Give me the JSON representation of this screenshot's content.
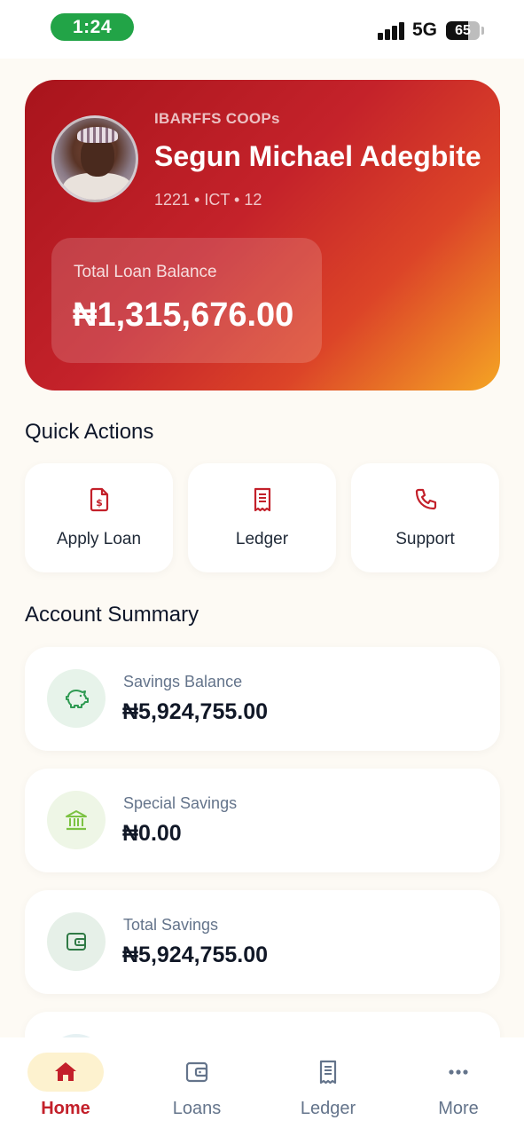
{
  "status_bar": {
    "time": "1:24",
    "network": "5G",
    "battery": "65",
    "battery_level": 0.65
  },
  "profile": {
    "org": "IBARFFS COOPs",
    "name": "Segun Michael Adegbite",
    "meta": "1221 • ICT • 12",
    "loan_label": "Total Loan Balance",
    "loan_amount": "₦1,315,676.00"
  },
  "quick_actions": {
    "title": "Quick Actions",
    "items": [
      {
        "label": "Apply Loan",
        "icon": "loan-document-icon"
      },
      {
        "label": "Ledger",
        "icon": "receipt-icon"
      },
      {
        "label": "Support",
        "icon": "phone-icon"
      }
    ]
  },
  "account_summary": {
    "title": "Account Summary",
    "items": [
      {
        "label": "Savings Balance",
        "value": "₦5,924,755.00",
        "icon": "piggy-bank-icon",
        "icon_color": "#2f9a52",
        "icon_bg": "#e7f3ea"
      },
      {
        "label": "Special Savings",
        "value": "₦0.00",
        "icon": "bank-icon",
        "icon_color": "#7cc242",
        "icon_bg": "#eef6e6"
      },
      {
        "label": "Total Savings",
        "value": "₦5,924,755.00",
        "icon": "wallet-icon",
        "icon_color": "#2f7a45",
        "icon_bg": "#e6f0e8"
      }
    ]
  },
  "bottom_nav": {
    "items": [
      {
        "label": "Home",
        "icon": "home-icon",
        "active": true
      },
      {
        "label": "Loans",
        "icon": "wallet-icon",
        "active": false
      },
      {
        "label": "Ledger",
        "icon": "receipt-icon",
        "active": false
      },
      {
        "label": "More",
        "icon": "more-icon",
        "active": false
      }
    ]
  },
  "colors": {
    "accent": "#c3202a",
    "background": "#fdfaf4",
    "nav_active_bg": "#fdf2cf"
  }
}
